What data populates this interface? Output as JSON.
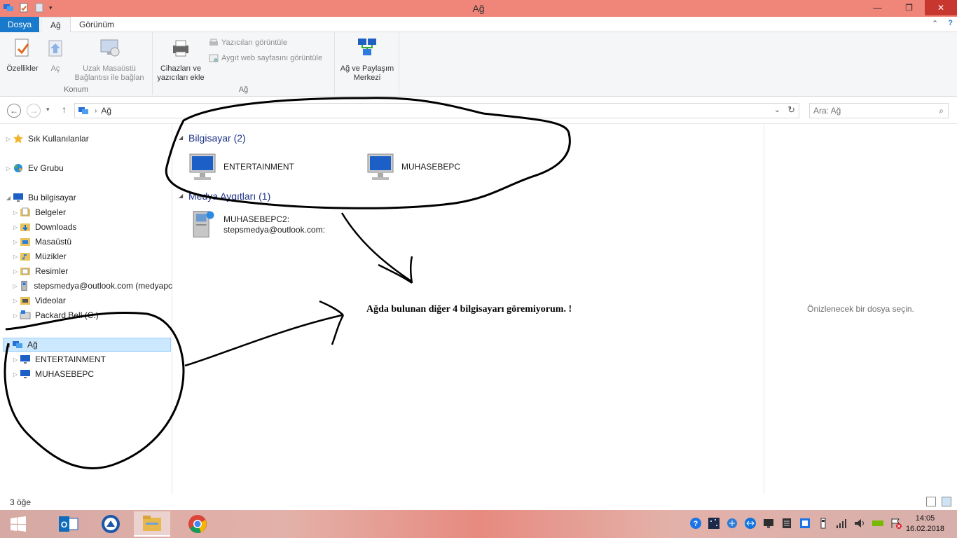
{
  "window": {
    "title": "Ağ"
  },
  "ribbon": {
    "tabs": {
      "file": "Dosya",
      "network": "Ağ",
      "view": "Görünüm"
    },
    "properties": "Özellikler",
    "open": "Aç",
    "remote_desktop_1": "Uzak Masaüstü",
    "remote_desktop_2": "Bağlantısı ile bağlan",
    "location_group": "Konum",
    "add_devices_1": "Cihazları ve",
    "add_devices_2": "yazıcıları ekle",
    "view_printers": "Yazıcıları görüntüle",
    "view_device_webpage": "Aygıt web sayfasını görüntüle",
    "network_group": "Ağ",
    "sharing_center_1": "Ağ ve Paylaşım",
    "sharing_center_2": "Merkezi"
  },
  "address": {
    "path": "Ağ"
  },
  "search": {
    "placeholder": "Ara: Ağ"
  },
  "nav": {
    "favorites": "Sık Kullanılanlar",
    "homegroup": "Ev Grubu",
    "this_pc": "Bu bilgisayar",
    "documents": "Belgeler",
    "downloads": "Downloads",
    "desktop": "Masaüstü",
    "music": "Müzikler",
    "pictures": "Resimler",
    "media_server": "stepsmedya@outlook.com (medyapc",
    "videos": "Videolar",
    "drive_c": "Packard Bell (C:)",
    "network": "Ağ",
    "pc1": "ENTERTAINMENT",
    "pc2": "MUHASEBEPC"
  },
  "content": {
    "computers_header": "Bilgisayar (2)",
    "computer_1": "ENTERTAINMENT",
    "computer_2": "MUHASEBEPC",
    "media_header": "Medya Aygıtları (1)",
    "media_1_line1": "MUHASEBEPC2:",
    "media_1_line2": "stepsmedya@outlook.com:",
    "annotation": "Ağda bulunan diğer 4 bilgisayarı göremiyorum. !"
  },
  "preview": {
    "message": "Önizlenecek bir dosya seçin."
  },
  "status": {
    "count": "3 öğe"
  },
  "clock": {
    "time": "14:05",
    "date": "16.02.2018"
  },
  "colors": {
    "titlebar": "#f0857a",
    "file_tab": "#1979ca",
    "selection": "#cce8ff",
    "close": "#c7372f"
  }
}
